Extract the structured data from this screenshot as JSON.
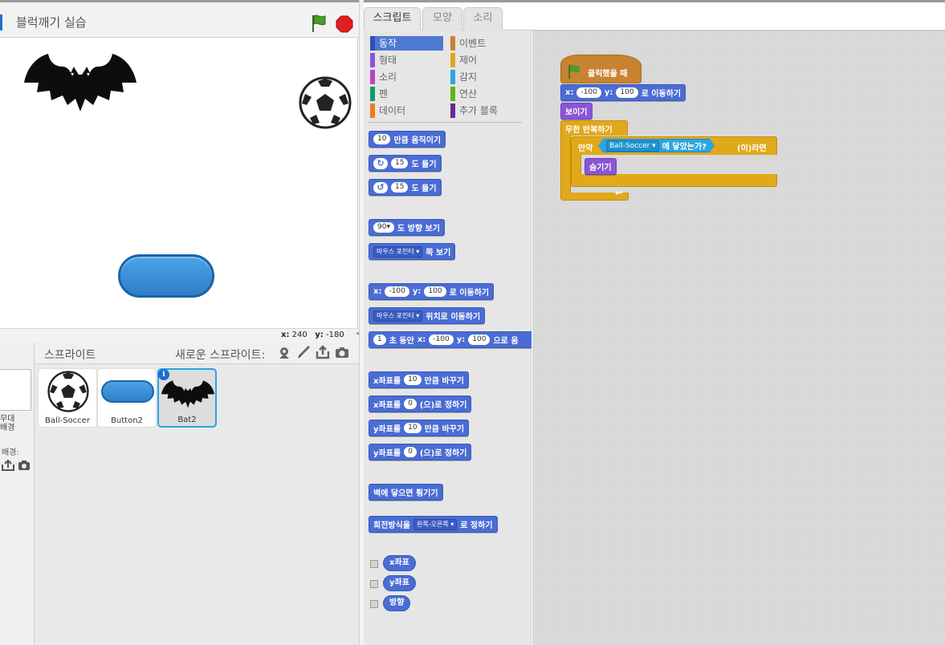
{
  "project": {
    "title": "블럭깨기 실습"
  },
  "stage": {
    "coords": {
      "x_label": "x:",
      "x_value": "240",
      "y_label": "y:",
      "y_value": "-180"
    }
  },
  "sprite_library": {
    "title": "스프라이트",
    "new_sprite_label": "새로운 스프라이트:",
    "stage_thumb_label_1": "무대",
    "stage_thumb_label_2": "배경",
    "new_backdrop_label": "배경:",
    "sprites": [
      {
        "name": "Ball-Soccer"
      },
      {
        "name": "Button2"
      },
      {
        "name": "Bat2",
        "selected": true
      }
    ],
    "info_badge": "i"
  },
  "tabs": [
    {
      "label": "스크립트",
      "active": true
    },
    {
      "label": "모양",
      "active": false
    },
    {
      "label": "소리",
      "active": false
    }
  ],
  "categories": [
    {
      "label": "동작",
      "color": "#4a6cd4",
      "active": true
    },
    {
      "label": "이벤트",
      "color": "#c88330"
    },
    {
      "label": "형태",
      "color": "#8a55d7"
    },
    {
      "label": "제어",
      "color": "#e1a91a"
    },
    {
      "label": "소리",
      "color": "#bb42c3"
    },
    {
      "label": "감지",
      "color": "#2ca5e2"
    },
    {
      "label": "펜",
      "color": "#0e9a6c"
    },
    {
      "label": "연산",
      "color": "#5cb712"
    },
    {
      "label": "데이터",
      "color": "#ee7d16"
    },
    {
      "label": "추가 블록",
      "color": "#632d99"
    }
  ],
  "palette": {
    "move": {
      "n": "10",
      "t": "만큼 움직이기"
    },
    "turn_cw": {
      "n": "15",
      "t": "도 돌기"
    },
    "turn_ccw": {
      "n": "15",
      "t": "도 돌기"
    },
    "point_dir": {
      "n": "90",
      "t": "도 방향 보기"
    },
    "point_towards": {
      "d": "마우스 포인터",
      "t": "쪽 보기"
    },
    "goto_xy": {
      "xl": "x:",
      "x": "-100",
      "yl": "y:",
      "y": "100",
      "t": "로 이동하기"
    },
    "goto_target": {
      "d": "마우스 포인터",
      "t": "위치로 이동하기"
    },
    "glide": {
      "n": "1",
      "t1": "초 동안",
      "xl": "x:",
      "x": "-100",
      "yl": "y:",
      "y": "100",
      "t2": "으로 움"
    },
    "change_x": {
      "a": "x좌표를",
      "n": "10",
      "t": "만큼 바꾸기"
    },
    "set_x": {
      "a": "x좌표를",
      "n": "0",
      "t": "(으)로 정하기"
    },
    "change_y": {
      "a": "y좌표를",
      "n": "10",
      "t": "만큼 바꾸기"
    },
    "set_y": {
      "a": "y좌표를",
      "n": "0",
      "t": "(으)로 정하기"
    },
    "bounce": {
      "t": "벽에 닿으면 튕기기"
    },
    "rotation_style": {
      "a": "회전방식을",
      "d": "왼쪽-오른쪽",
      "t": "로 정하기"
    },
    "reporters": [
      "x좌표",
      "y좌표",
      "방향"
    ]
  },
  "script": {
    "hat": "클릭했을 때",
    "goto": {
      "xl": "x:",
      "x": "-100",
      "yl": "y:",
      "y": "100",
      "t": "로 이동하기"
    },
    "show": "보이기",
    "forever": "무한 반복하기",
    "if_label": "만약",
    "touching_target": "Ball-Soccer",
    "touching_text": "에 닿았는가?",
    "if_then": "(이)라면",
    "hide": "숨기기",
    "loop_arrow": "↩"
  }
}
